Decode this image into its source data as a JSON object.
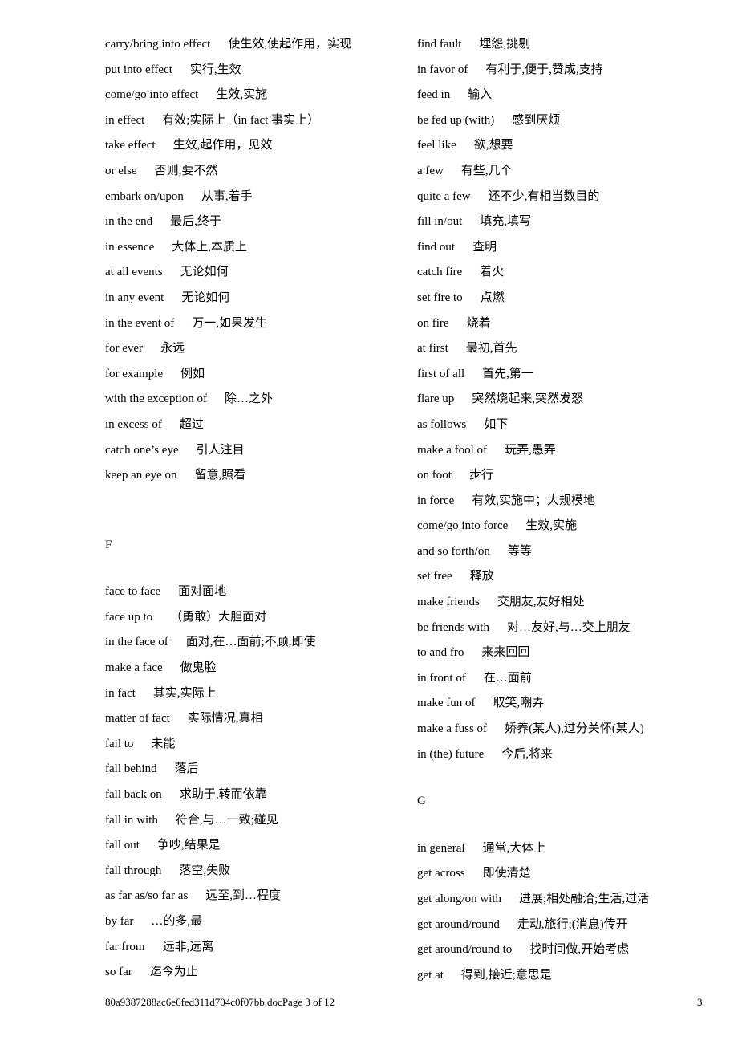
{
  "left_column": {
    "entries_e": [
      {
        "en": "carry/bring into effect",
        "zh": "使生效,使起作用，实现"
      },
      {
        "en": "put into effect",
        "zh": "实行,生效"
      },
      {
        "en": "come/go into effect",
        "zh": "生效,实施"
      },
      {
        "en": "in effect",
        "zh": "有效;实际上（in fact 事实上）"
      },
      {
        "en": "take effect",
        "zh": "生效,起作用，见效"
      },
      {
        "en": "or else",
        "zh": "否则,要不然"
      },
      {
        "en": "embark on/upon",
        "zh": "从事,着手"
      },
      {
        "en": "in the end",
        "zh": "最后,终于"
      },
      {
        "en": "in essence",
        "zh": "大体上,本质上"
      },
      {
        "en": "at all events",
        "zh": "无论如何"
      },
      {
        "en": "in any event",
        "zh": "无论如何"
      },
      {
        "en": "in the event of",
        "zh": "万一,如果发生"
      },
      {
        "en": "for ever",
        "zh": "永远"
      },
      {
        "en": "for example",
        "zh": "例如"
      },
      {
        "en": "with the exception of",
        "zh": "除…之外"
      },
      {
        "en": "in excess of",
        "zh": "超过"
      },
      {
        "en": "catch one’s eye",
        "zh": "引人注目"
      },
      {
        "en": "keep an eye on",
        "zh": "留意,照看"
      }
    ],
    "section_f_heading": "F",
    "entries_f": [
      {
        "en": "face to face",
        "zh": "面对面地"
      },
      {
        "en": "face up to",
        "zh": "（勇敢）大胆面对"
      },
      {
        "en": "in the face of",
        "zh": "面对,在…面前;不顾,即使"
      },
      {
        "en": "make a face",
        "zh": "做鬼脸"
      },
      {
        "en": "in fact",
        "zh": "其实,实际上"
      },
      {
        "en": "matter of fact",
        "zh": "实际情况,真相"
      },
      {
        "en": "fail to",
        "zh": "未能"
      },
      {
        "en": "fall behind",
        "zh": "落后"
      },
      {
        "en": "fall back on",
        "zh": "求助于,转而依靠"
      },
      {
        "en": "fall in with",
        "zh": "符合,与…一致;碰见"
      },
      {
        "en": "fall out",
        "zh": "争吵,结果是"
      },
      {
        "en": "fall through",
        "zh": "落空,失败"
      },
      {
        "en": "as far as/so far as",
        "zh": "远至,到…程度"
      },
      {
        "en": "by far",
        "zh": "…的多,最"
      },
      {
        "en": "far from",
        "zh": "远非,远离"
      },
      {
        "en": "so far",
        "zh": "迄今为止"
      }
    ]
  },
  "right_column": {
    "entries_f": [
      {
        "en": "find fault",
        "zh": "埋怨,挑剔"
      },
      {
        "en": "in favor of",
        "zh": "有利于,便于,赞成,支持"
      },
      {
        "en": "feed in",
        "zh": "输入"
      },
      {
        "en": "be fed up (with)",
        "zh": "感到厌烦"
      },
      {
        "en": "feel like",
        "zh": "欲,想要"
      },
      {
        "en": "a few",
        "zh": "有些,几个"
      },
      {
        "en": "quite a few",
        "zh": "还不少,有相当数目的"
      },
      {
        "en": "fill in/out",
        "zh": "填充,填写"
      },
      {
        "en": "find out",
        "zh": "查明"
      },
      {
        "en": "catch fire",
        "zh": "着火"
      },
      {
        "en": "set fire to",
        "zh": "点燃"
      },
      {
        "en": "on fire",
        "zh": "烧着"
      },
      {
        "en": "at first",
        "zh": "最初,首先"
      },
      {
        "en": "first of all",
        "zh": "首先,第一"
      },
      {
        "en": "flare up",
        "zh": "突然烧起来,突然发怒"
      },
      {
        "en": "as follows",
        "zh": "如下"
      },
      {
        "en": "make a fool of",
        "zh": "玩弄,愚弄"
      },
      {
        "en": "on foot",
        "zh": "步行"
      },
      {
        "en": "in force",
        "zh": "有效,实施中；大规模地"
      },
      {
        "en": "come/go into force",
        "zh": "生效,实施"
      },
      {
        "en": "and so forth/on",
        "zh": "等等"
      },
      {
        "en": "set free",
        "zh": "释放"
      },
      {
        "en": "make friends",
        "zh": "交朋友,友好相处"
      },
      {
        "en": "be friends with",
        "zh": "对…友好,与…交上朋友"
      },
      {
        "en": "to and fro",
        "zh": "来来回回"
      },
      {
        "en": "in front of",
        "zh": "在…面前"
      },
      {
        "en": "make fun of",
        "zh": "取笑,嘲弄"
      },
      {
        "en": "make a fuss of",
        "zh": "娇养(某人),过分关怀(某人)"
      },
      {
        "en": "in (the) future",
        "zh": "今后,将来"
      }
    ],
    "section_g_heading": "G",
    "entries_g": [
      {
        "en": "in general",
        "zh": "通常,大体上"
      },
      {
        "en": "get across",
        "zh": "即使清楚"
      },
      {
        "en": "get along/on with",
        "zh": "进展;相处融洽;生活,过活"
      },
      {
        "en": "get around/round",
        "zh": "走动,旅行;(消息)传开"
      },
      {
        "en": "get around/round to",
        "zh": "找时间做,开始考虑"
      },
      {
        "en": "get at",
        "zh": "得到,接近;意思是"
      }
    ]
  },
  "footer": {
    "filename_page": "80a9387288ac6e6fed311d704c0f07bb.docPage 3 of 12",
    "page_number": "3"
  }
}
